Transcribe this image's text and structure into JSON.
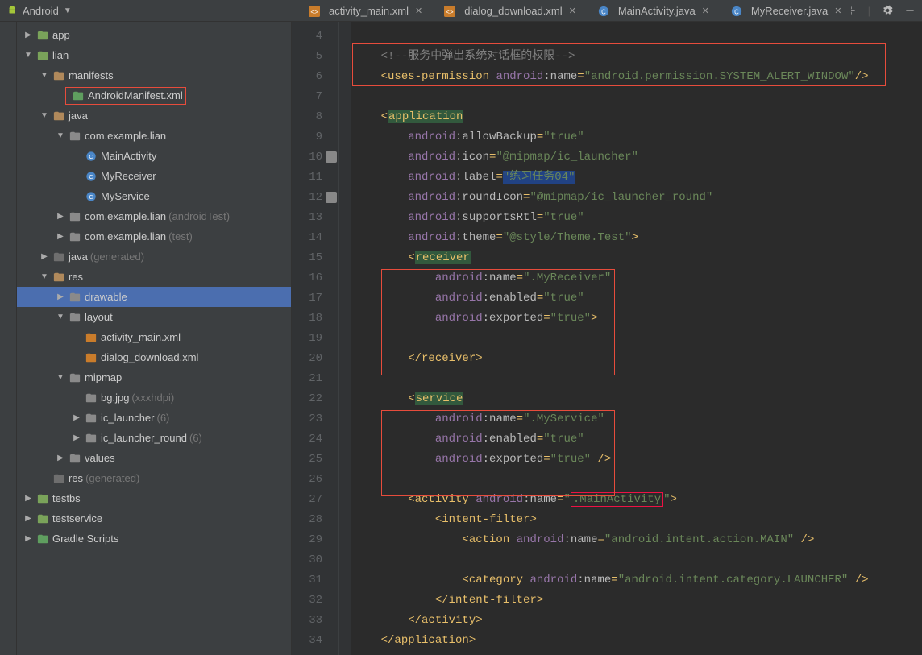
{
  "topbar": {
    "project": "Android",
    "tabs": [
      {
        "name": "activity_main.xml",
        "icon": "xml",
        "active": false
      },
      {
        "name": "dialog_download.xml",
        "icon": "xml",
        "active": false
      },
      {
        "name": "MainActivity.java",
        "icon": "java",
        "active": false
      },
      {
        "name": "MyReceiver.java",
        "icon": "java",
        "active": false
      }
    ]
  },
  "tree": [
    {
      "d": 0,
      "a": "r",
      "ic": "mod",
      "t": "app"
    },
    {
      "d": 0,
      "a": "d",
      "ic": "mod",
      "t": "lian"
    },
    {
      "d": 1,
      "a": "d",
      "ic": "dir",
      "t": "manifests"
    },
    {
      "d": 2,
      "a": "",
      "ic": "mf",
      "t": "AndroidManifest.xml",
      "box": true
    },
    {
      "d": 1,
      "a": "d",
      "ic": "dir",
      "t": "java"
    },
    {
      "d": 2,
      "a": "d",
      "ic": "pkg",
      "t": "com.example.lian"
    },
    {
      "d": 3,
      "a": "",
      "ic": "cls",
      "t": "MainActivity"
    },
    {
      "d": 3,
      "a": "",
      "ic": "cls",
      "t": "MyReceiver"
    },
    {
      "d": 3,
      "a": "",
      "ic": "cls",
      "t": "MyService"
    },
    {
      "d": 2,
      "a": "r",
      "ic": "pkg",
      "t": "com.example.lian",
      "m": "(androidTest)"
    },
    {
      "d": 2,
      "a": "r",
      "ic": "pkg",
      "t": "com.example.lian",
      "m": "(test)"
    },
    {
      "d": 1,
      "a": "r",
      "ic": "gen",
      "t": "java",
      "m": "(generated)"
    },
    {
      "d": 1,
      "a": "d",
      "ic": "dir",
      "t": "res"
    },
    {
      "d": 2,
      "a": "r",
      "ic": "pkg",
      "t": "drawable",
      "sel": true
    },
    {
      "d": 2,
      "a": "d",
      "ic": "pkg",
      "t": "layout"
    },
    {
      "d": 3,
      "a": "",
      "ic": "xml",
      "t": "activity_main.xml"
    },
    {
      "d": 3,
      "a": "",
      "ic": "xml",
      "t": "dialog_download.xml"
    },
    {
      "d": 2,
      "a": "d",
      "ic": "pkg",
      "t": "mipmap"
    },
    {
      "d": 3,
      "a": "",
      "ic": "img",
      "t": "bg.jpg",
      "m": "(xxxhdpi)"
    },
    {
      "d": 3,
      "a": "r",
      "ic": "pkg",
      "t": "ic_launcher",
      "m": "(6)"
    },
    {
      "d": 3,
      "a": "r",
      "ic": "pkg",
      "t": "ic_launcher_round",
      "m": "(6)"
    },
    {
      "d": 2,
      "a": "r",
      "ic": "pkg",
      "t": "values"
    },
    {
      "d": 1,
      "a": "",
      "ic": "gen",
      "t": "res",
      "m": "(generated)"
    },
    {
      "d": 0,
      "a": "r",
      "ic": "mod",
      "t": "testbs"
    },
    {
      "d": 0,
      "a": "r",
      "ic": "mod",
      "t": "testservice"
    },
    {
      "d": 0,
      "a": "r",
      "ic": "grd",
      "t": "Gradle Scripts"
    }
  ],
  "gutter": {
    "start": 4,
    "end": 34,
    "icons": [
      10,
      12
    ]
  },
  "code": {
    "comment": "<!--服务中弹出系统对话框的权限-->",
    "perm_tag": "uses-permission",
    "perm_attr_ns": "android",
    "perm_attr": "name",
    "perm_val": "android.permission.SYSTEM_ALERT_WINDOW",
    "app_tag": "application",
    "app_attrs": [
      {
        "ns": "android",
        "n": "allowBackup",
        "v": "true"
      },
      {
        "ns": "android",
        "n": "icon",
        "v": "@mipmap/ic_launcher"
      },
      {
        "ns": "android",
        "n": "label",
        "v": "练习任务04",
        "hl": true
      },
      {
        "ns": "android",
        "n": "roundIcon",
        "v": "@mipmap/ic_launcher_round"
      },
      {
        "ns": "android",
        "n": "supportsRtl",
        "v": "true"
      },
      {
        "ns": "android",
        "n": "theme",
        "v": "@style/Theme.Test",
        "close": true
      }
    ],
    "recv_tag": "receiver",
    "recv_attrs": [
      {
        "ns": "android",
        "n": "name",
        "v": ".MyReceiver"
      },
      {
        "ns": "android",
        "n": "enabled",
        "v": "true"
      },
      {
        "ns": "android",
        "n": "exported",
        "v": "true",
        "close": true
      }
    ],
    "recv_close": "</receiver>",
    "svc_tag": "service",
    "svc_attrs": [
      {
        "ns": "android",
        "n": "name",
        "v": ".MyService"
      },
      {
        "ns": "android",
        "n": "enabled",
        "v": "true"
      },
      {
        "ns": "android",
        "n": "exported",
        "v": "true",
        "selfclose": true
      }
    ],
    "act_tag": "activity",
    "act_ns": "android",
    "act_attr": "name",
    "act_val": ".MainActivity",
    "if_open": "<intent-filter>",
    "action_ns": "android",
    "action_attr": "name",
    "action_val": "android.intent.action.MAIN",
    "cat_ns": "android",
    "cat_attr": "name",
    "cat_val": "android.intent.category.LAUNCHER",
    "if_close": "</intent-filter>",
    "act_close": "</activity>",
    "app_close": "</application>"
  }
}
